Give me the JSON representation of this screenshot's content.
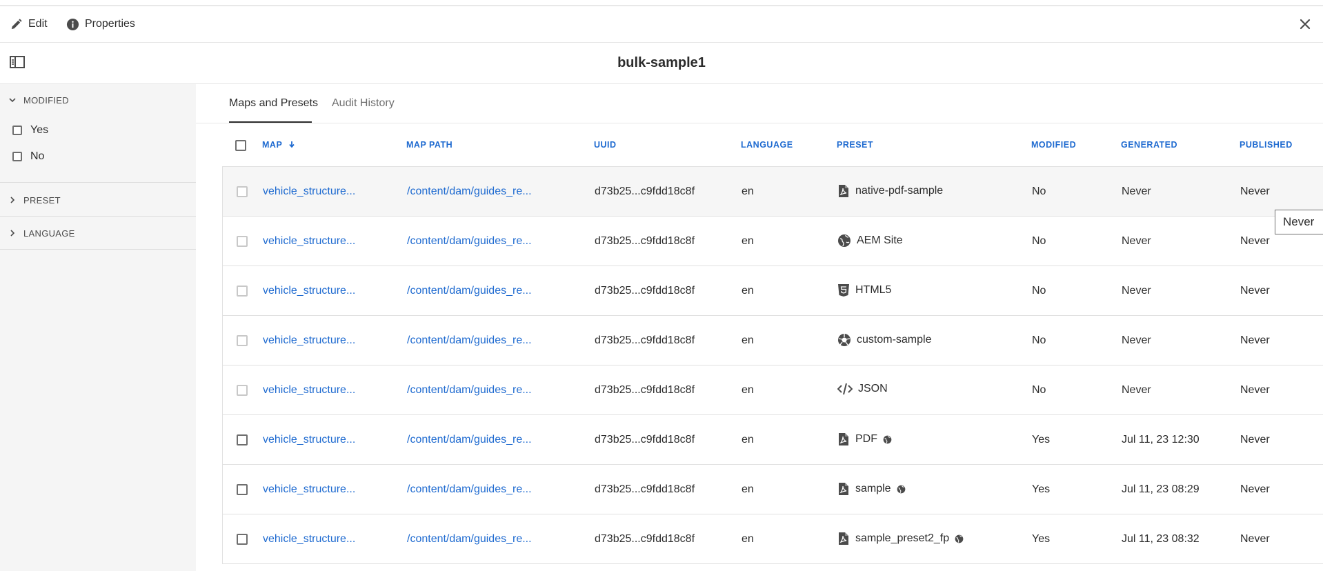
{
  "toolbar": {
    "edit_label": "Edit",
    "properties_label": "Properties"
  },
  "header": {
    "title": "bulk-sample1"
  },
  "sidebar": {
    "facets": [
      {
        "label": "MODIFIED",
        "expanded": true,
        "options": [
          "Yes",
          "No"
        ]
      },
      {
        "label": "PRESET",
        "expanded": false
      },
      {
        "label": "LANGUAGE",
        "expanded": false
      }
    ]
  },
  "tabs": [
    {
      "label": "Maps and Presets",
      "active": true
    },
    {
      "label": "Audit History",
      "active": false
    }
  ],
  "table": {
    "columns": [
      "MAP",
      "MAP PATH",
      "UUID",
      "LANGUAGE",
      "PRESET",
      "MODIFIED",
      "GENERATED",
      "PUBLISHED"
    ],
    "sort_column": "MAP",
    "rows": [
      {
        "map": "vehicle_structure...",
        "path": "/content/dam/guides_re...",
        "uuid": "d73b25...c9fdd18c8f",
        "language": "en",
        "preset": "native-pdf-sample",
        "preset_icon": "pdf-icon",
        "modified": "No",
        "generated": "Never",
        "published": "Never"
      },
      {
        "map": "vehicle_structure...",
        "path": "/content/dam/guides_re...",
        "uuid": "d73b25...c9fdd18c8f",
        "language": "en",
        "preset": "AEM Site",
        "preset_icon": "globe-icon",
        "modified": "No",
        "generated": "Never",
        "published": "Never"
      },
      {
        "map": "vehicle_structure...",
        "path": "/content/dam/guides_re...",
        "uuid": "d73b25...c9fdd18c8f",
        "language": "en",
        "preset": "HTML5",
        "preset_icon": "html5-icon",
        "modified": "No",
        "generated": "Never",
        "published": "Never"
      },
      {
        "map": "vehicle_structure...",
        "path": "/content/dam/guides_re...",
        "uuid": "d73b25...c9fdd18c8f",
        "language": "en",
        "preset": "custom-sample",
        "preset_icon": "aperture-icon",
        "modified": "No",
        "generated": "Never",
        "published": "Never"
      },
      {
        "map": "vehicle_structure...",
        "path": "/content/dam/guides_re...",
        "uuid": "d73b25...c9fdd18c8f",
        "language": "en",
        "preset": "JSON",
        "preset_icon": "code-icon",
        "modified": "No",
        "generated": "Never",
        "published": "Never"
      },
      {
        "map": "vehicle_structure...",
        "path": "/content/dam/guides_re...",
        "uuid": "d73b25...c9fdd18c8f",
        "language": "en",
        "preset": "PDF",
        "preset_icon": "pdf-icon",
        "has_globe": true,
        "modified": "Yes",
        "generated": "Jul 11, 23 12:30",
        "published": "Never"
      },
      {
        "map": "vehicle_structure...",
        "path": "/content/dam/guides_re...",
        "uuid": "d73b25...c9fdd18c8f",
        "language": "en",
        "preset": "sample",
        "preset_icon": "pdf-icon",
        "has_globe": true,
        "modified": "Yes",
        "generated": "Jul 11, 23 08:29",
        "published": "Never"
      },
      {
        "map": "vehicle_structure...",
        "path": "/content/dam/guides_re...",
        "uuid": "d73b25...c9fdd18c8f",
        "language": "en",
        "preset": "sample_preset2_fp",
        "preset_icon": "pdf-icon",
        "has_globe": true,
        "modified": "Yes",
        "generated": "Jul 11, 23 08:32",
        "published": "Never"
      }
    ]
  },
  "tooltip": {
    "text": "Never"
  },
  "colors": {
    "link": "#1e6ad0",
    "text": "#2c2c2c",
    "sidebar_bg": "#f5f5f5"
  }
}
